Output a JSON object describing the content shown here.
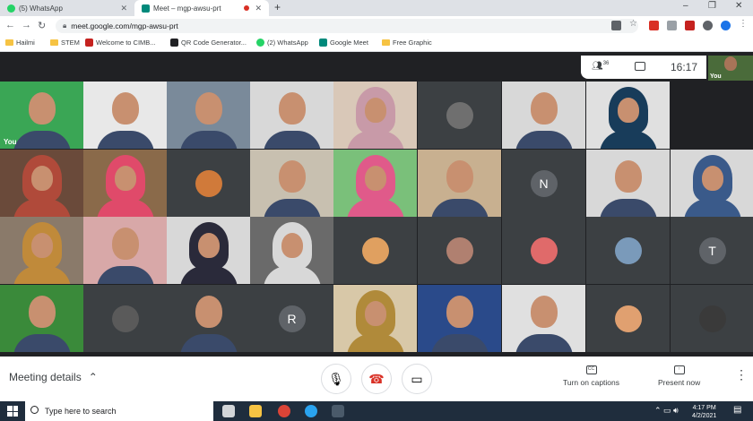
{
  "browser": {
    "tabs": [
      {
        "title": "(5) WhatsApp",
        "favicon_color": "#25d366"
      },
      {
        "title": "Meet – mgp-awsu-prt",
        "favicon_color": "#00897b"
      }
    ],
    "new_tab": "+",
    "window_controls": {
      "minimize": "–",
      "restore": "❐",
      "close": "✕"
    },
    "url": "meet.google.com/mgp-awsu-prt",
    "bookmarks": [
      {
        "label": "Hailmi",
        "icon": "folder-icon"
      },
      {
        "label": "STEM",
        "icon": "folder-icon"
      },
      {
        "label": "Welcome to CIMB...",
        "icon": "cimb-icon"
      },
      {
        "label": "QR Code Generator...",
        "icon": "qr-icon"
      },
      {
        "label": "(2) WhatsApp",
        "icon": "whatsapp-icon"
      },
      {
        "label": "Google Meet",
        "icon": "meet-icon"
      },
      {
        "label": "Free Graphic",
        "icon": "folder-icon"
      }
    ]
  },
  "meet": {
    "participant_count": "36",
    "time": "16:17",
    "self_label": "You",
    "you_tile_label": "You",
    "letter_avatars": [
      "N",
      "T",
      "R"
    ],
    "bottom": {
      "meeting_details": "Meeting details",
      "captions": "Turn on captions",
      "present": "Present now"
    }
  },
  "taskbar": {
    "search_placeholder": "Type here to search",
    "time": "4:17 PM",
    "date": "4/2/2021"
  }
}
